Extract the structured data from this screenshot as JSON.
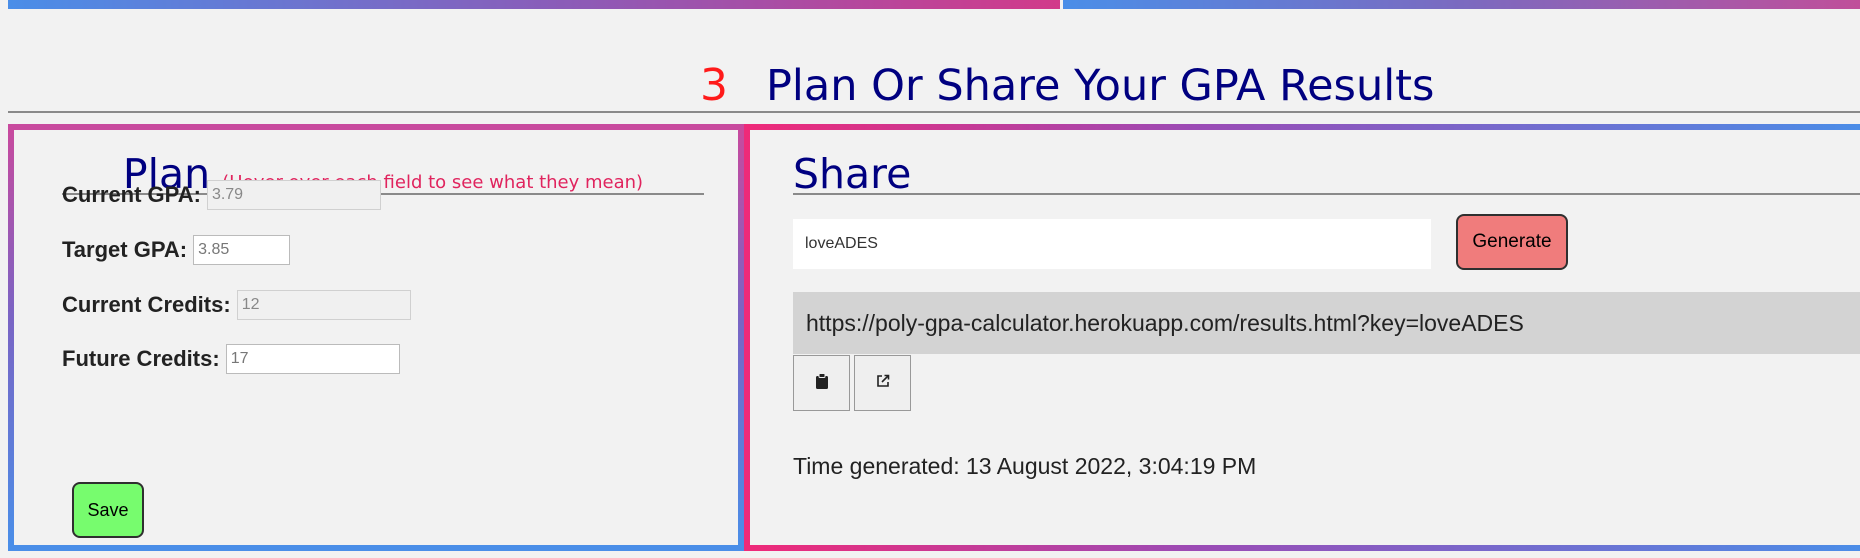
{
  "section": {
    "number": "3",
    "title": "Plan Or Share Your GPA Results"
  },
  "plan": {
    "heading": "Plan",
    "hint": "(Hover over each field to see what they mean)",
    "fields": {
      "current_gpa": {
        "label": "Current GPA:",
        "value": "3.79"
      },
      "target_gpa": {
        "label": "Target GPA:",
        "value": "3.85"
      },
      "current_credits": {
        "label": "Current Credits:",
        "value": "12"
      },
      "future_credits": {
        "label": "Future Credits:",
        "value": "17"
      }
    },
    "save_label": "Save"
  },
  "share": {
    "heading": "Share",
    "key_value": "loveADES",
    "generate_label": "Generate",
    "url": "https://poly-gpa-calculator.herokuapp.com/results.html?key=loveADES",
    "copy_icon": "clipboard-icon",
    "open_icon": "external-link-icon",
    "time_text": "Time generated: 13 August 2022, 3:04:19 PM"
  },
  "colors": {
    "heading": "#000080",
    "step_number": "#ff1a1a",
    "hint": "#e0245e",
    "save_button": "#77fc6e",
    "generate_button": "#f07c7c"
  }
}
